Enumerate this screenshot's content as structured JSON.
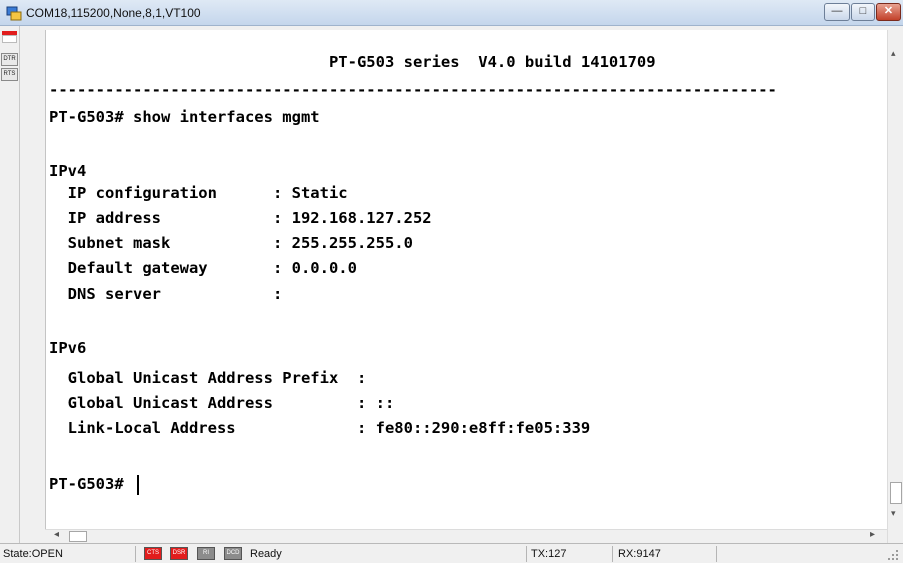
{
  "window": {
    "title": "COM18,115200,None,8,1,VT100",
    "min_symbol": "—",
    "max_symbol": "□",
    "close_symbol": "✕"
  },
  "sidebar": {
    "dtr_label": "DTR",
    "rts_label": "RTS",
    "led_color": "#e11d1d"
  },
  "terminal": {
    "lines": [
      "                              PT-G503 series  V4.0 build 14101709",
      "------------------------------------------------------------------------------",
      "PT-G503# show interfaces mgmt",
      "",
      "IPv4",
      "  IP configuration      : Static",
      "  IP address            : 192.168.127.252",
      "  Subnet mask           : 255.255.255.0",
      "  Default gateway       : 0.0.0.0",
      "  DNS server            :",
      "",
      "IPv6",
      "  Global Unicast Address Prefix  :",
      "  Global Unicast Address         : ::",
      "  Link-Local Address             : fe80::290:e8ff:fe05:339",
      "",
      "PT-G503# "
    ]
  },
  "scrollbars": {
    "up_arrow": "▴",
    "down_arrow": "▾",
    "left_arrow": "◂",
    "right_arrow": "▸"
  },
  "statusbar": {
    "state": "State:OPEN",
    "indicators": [
      {
        "label": "CTS",
        "color": "#e11d1d"
      },
      {
        "label": "DSR",
        "color": "#e11d1d"
      },
      {
        "label": "RI",
        "color": "#8c8c8c"
      },
      {
        "label": "DCD",
        "color": "#8c8c8c"
      }
    ],
    "ready": "Ready",
    "tx": "TX:127",
    "rx": "RX:9147"
  }
}
